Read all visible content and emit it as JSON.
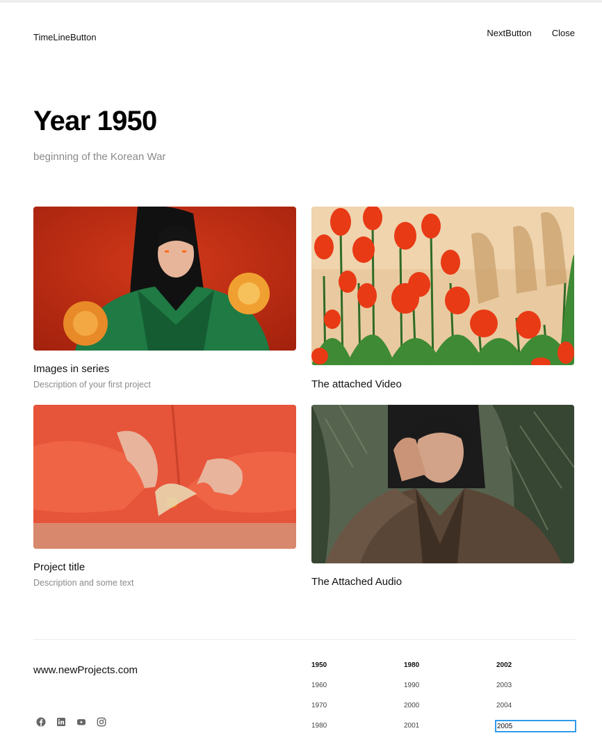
{
  "nav": {
    "timeline_label": "TimeLineButton",
    "next_label": "NextButton",
    "close_label": "Close"
  },
  "header": {
    "title": "Year 1950",
    "subtitle": "beginning of the Korean War"
  },
  "cards": [
    {
      "title": "Images in series",
      "description": "Description of your first project",
      "image": "woman-green-jacket-red-background"
    },
    {
      "title": "The attached Video",
      "image": "red-tulips"
    },
    {
      "title": "Project title",
      "description": "Description and some text",
      "image": "hands-red-shirt-physalis"
    },
    {
      "title": "The Attached Audio",
      "image": "woman-plaid-jacket-plants"
    }
  ],
  "footer": {
    "site": "www.newProjects.com",
    "socials": [
      "facebook-icon",
      "linkedin-icon",
      "youtube-icon",
      "instagram-icon"
    ],
    "year_columns": [
      [
        "1950",
        "1960",
        "1970",
        "1980"
      ],
      [
        "1980",
        "1990",
        "2000",
        "2001"
      ],
      [
        "2002",
        "2003",
        "2004"
      ]
    ],
    "year_input_value": "2005"
  },
  "colors": {
    "accent_focus": "#2f9bea",
    "muted_text": "#8a8a8a"
  }
}
